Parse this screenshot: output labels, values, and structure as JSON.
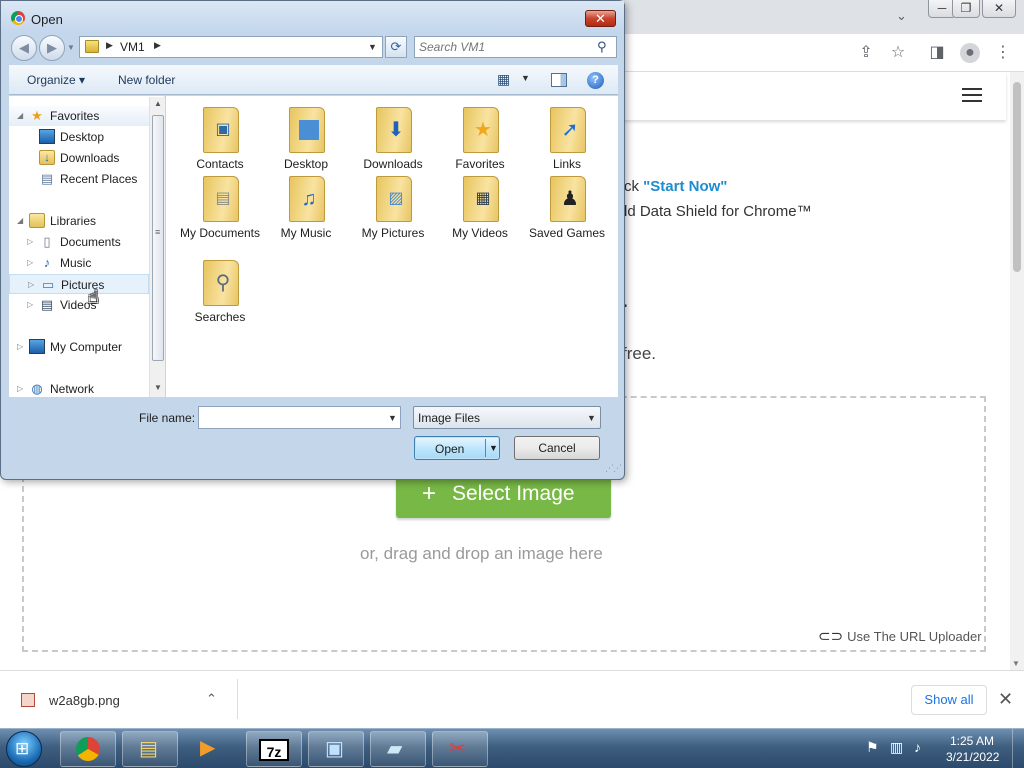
{
  "browser": {
    "window_controls": [
      "─",
      "❐",
      "✕"
    ],
    "tab_dropdown_icon": "chevron-down",
    "toolbar_icons": [
      "share-icon",
      "star-icon",
      "side-panel-icon",
      "profile-icon",
      "more-icon"
    ],
    "page": {
      "intro_line1_prefix": "ck ",
      "intro_line1_link": "\"Start Now\"",
      "intro_line2": "ld Data Shield for Chrome™",
      "heading_fragment": ".",
      "free_fragment": "free.",
      "select_image_plus": "+",
      "select_image_label": "Select Image",
      "drag_hint": "or, drag and drop an image here",
      "url_uploader_label": "Use The URL Uploader",
      "accent_color": "#78b846",
      "link_color": "#1e8ccf"
    },
    "download_bar": {
      "filename": "w2a8gb.png",
      "show_all_label": "Show all"
    }
  },
  "dialog": {
    "title": "Open",
    "close_label": "✕",
    "address": {
      "crumb": "VM1"
    },
    "search": {
      "placeholder": "Search VM1"
    },
    "commands": {
      "organize": "Organize ▾",
      "new_folder": "New folder",
      "help": "?"
    },
    "nav": {
      "favorites": "Favorites",
      "desktop": "Desktop",
      "downloads": "Downloads",
      "recent_places": "Recent Places",
      "libraries": "Libraries",
      "documents": "Documents",
      "music": "Music",
      "pictures": "Pictures",
      "videos": "Videos",
      "my_computer": "My Computer",
      "network": "Network"
    },
    "files": [
      {
        "name": "Contacts",
        "icon": "contacts-icon"
      },
      {
        "name": "Desktop",
        "icon": "desktop-icon"
      },
      {
        "name": "Downloads",
        "icon": "download-arrow-icon"
      },
      {
        "name": "Favorites",
        "icon": "star-icon"
      },
      {
        "name": "Links",
        "icon": "link-arrow-icon"
      },
      {
        "name": "My Documents",
        "icon": "document-icon"
      },
      {
        "name": "My Music",
        "icon": "music-note-icon"
      },
      {
        "name": "My Pictures",
        "icon": "picture-icon"
      },
      {
        "name": "My Videos",
        "icon": "film-icon"
      },
      {
        "name": "Saved Games",
        "icon": "chess-piece-icon"
      },
      {
        "name": "Searches",
        "icon": "magnifier-icon"
      }
    ],
    "filename_label": "File name:",
    "filename_value": "",
    "filetype_value": "Image Files",
    "open_label": "Open",
    "cancel_label": "Cancel"
  },
  "taskbar": {
    "apps": [
      "chrome-icon",
      "explorer-icon",
      "media-player-icon",
      "7zip-icon",
      "remote-desktop-icon",
      "notepad-icon",
      "snipping-tool-icon"
    ],
    "sevenzip_label": "7z",
    "time": "1:25 AM",
    "date": "3/21/2022"
  }
}
